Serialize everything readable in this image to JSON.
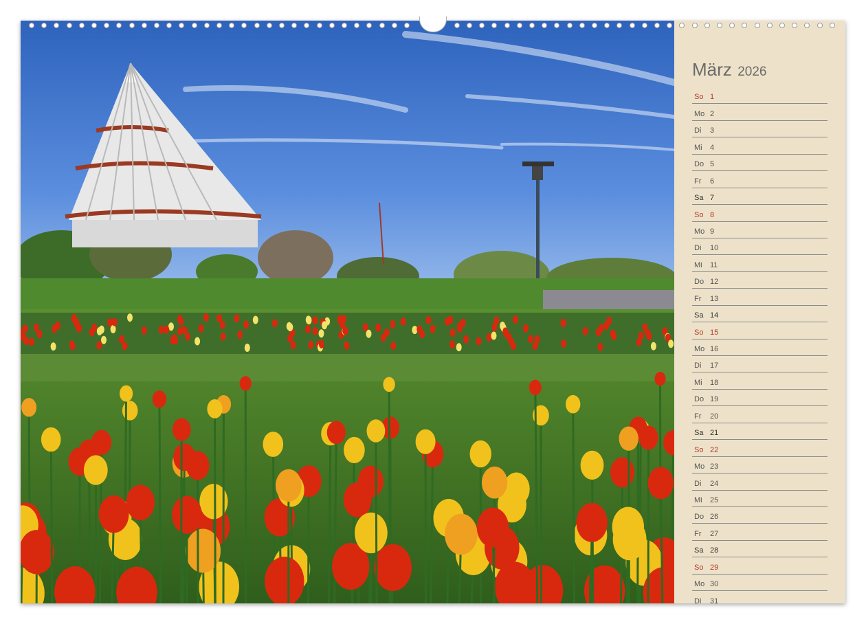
{
  "calendar": {
    "month": "März",
    "year": "2026",
    "days": [
      {
        "weekday": "So",
        "day": "1"
      },
      {
        "weekday": "Mo",
        "day": "2"
      },
      {
        "weekday": "Di",
        "day": "3"
      },
      {
        "weekday": "Mi",
        "day": "4"
      },
      {
        "weekday": "Do",
        "day": "5"
      },
      {
        "weekday": "Fr",
        "day": "6"
      },
      {
        "weekday": "Sa",
        "day": "7"
      },
      {
        "weekday": "So",
        "day": "8"
      },
      {
        "weekday": "Mo",
        "day": "9"
      },
      {
        "weekday": "Di",
        "day": "10"
      },
      {
        "weekday": "Mi",
        "day": "11"
      },
      {
        "weekday": "Do",
        "day": "12"
      },
      {
        "weekday": "Fr",
        "day": "13"
      },
      {
        "weekday": "Sa",
        "day": "14"
      },
      {
        "weekday": "So",
        "day": "15"
      },
      {
        "weekday": "Mo",
        "day": "16"
      },
      {
        "weekday": "Di",
        "day": "17"
      },
      {
        "weekday": "Mi",
        "day": "18"
      },
      {
        "weekday": "Do",
        "day": "19"
      },
      {
        "weekday": "Fr",
        "day": "20"
      },
      {
        "weekday": "Sa",
        "day": "21"
      },
      {
        "weekday": "So",
        "day": "22"
      },
      {
        "weekday": "Mo",
        "day": "23"
      },
      {
        "weekday": "Di",
        "day": "24"
      },
      {
        "weekday": "Mi",
        "day": "25"
      },
      {
        "weekday": "Do",
        "day": "26"
      },
      {
        "weekday": "Fr",
        "day": "27"
      },
      {
        "weekday": "Sa",
        "day": "28"
      },
      {
        "weekday": "So",
        "day": "29"
      },
      {
        "weekday": "Mo",
        "day": "30"
      },
      {
        "weekday": "Di",
        "day": "31"
      }
    ]
  },
  "colors": {
    "panel_background": "#ede2c9",
    "sunday_text": "#b53a2c",
    "weekday_text": "#555555",
    "title_text": "#6b6b6b",
    "sky": "#3f73c9",
    "grass": "#4f8a2e",
    "tulip_red": "#d8290f",
    "tulip_yellow": "#f2c21c"
  },
  "photo": {
    "subject": "tulip field with conical tower"
  }
}
